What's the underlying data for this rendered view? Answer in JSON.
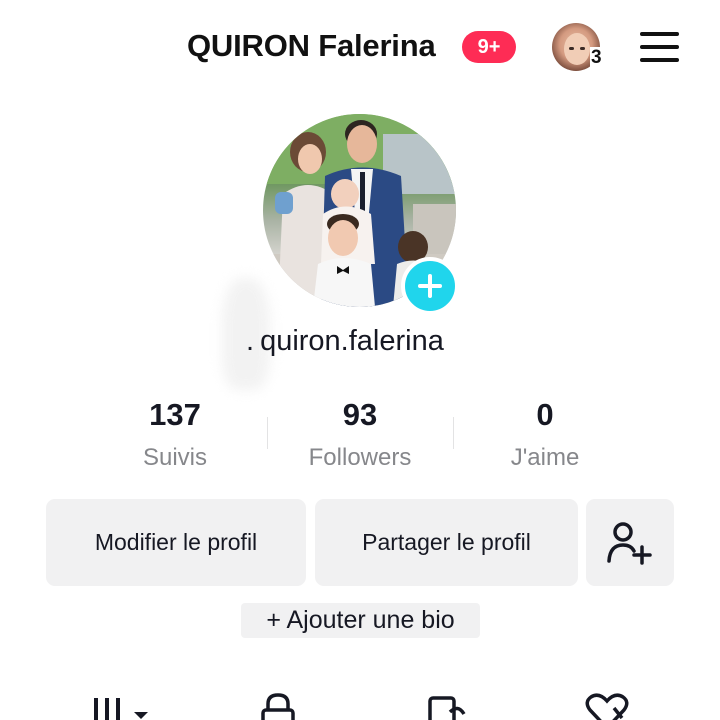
{
  "header": {
    "title": "QUIRON Falerina",
    "notification_badge": "9+",
    "account_count": "3",
    "menu_icon": "hamburger-menu-icon"
  },
  "profile": {
    "handle": "quiron.falerina",
    "add_photo_icon": "plus-icon"
  },
  "stats": [
    {
      "value": "137",
      "label": "Suivis"
    },
    {
      "value": "93",
      "label": "Followers"
    },
    {
      "value": "0",
      "label": "J'aime"
    }
  ],
  "actions": {
    "edit_profile": "Modifier le profil",
    "share_profile": "Partager le profil",
    "add_friend_icon": "add-user-icon",
    "add_bio": "+ Ajouter une bio"
  },
  "tabs": [
    {
      "icon": "grid-icon"
    },
    {
      "icon": "lock-icon"
    },
    {
      "icon": "repost-icon"
    },
    {
      "icon": "liked-heart-icon"
    }
  ],
  "colors": {
    "brand": "#fe2c55",
    "accent": "#20d5ec",
    "text": "#161823",
    "secondary_text": "#86878b",
    "button_bg": "#f1f1f2"
  }
}
